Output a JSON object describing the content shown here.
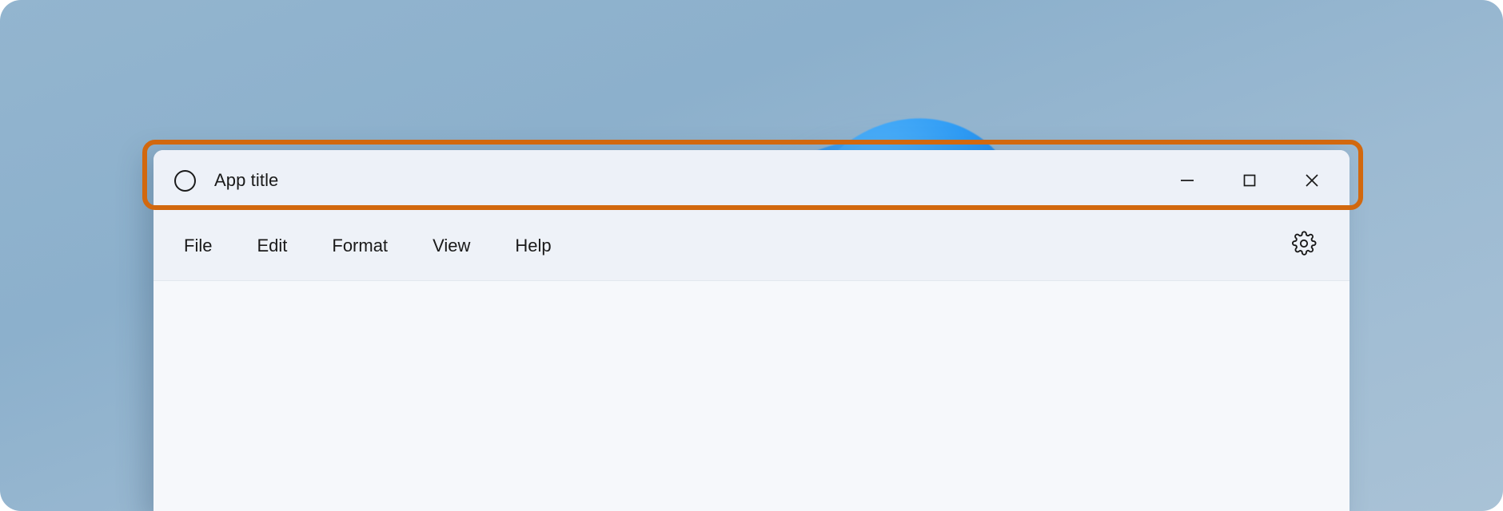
{
  "window": {
    "title": "App title",
    "app_icon": "circle-outline-icon",
    "controls": [
      {
        "name": "minimize",
        "glyph": "minimize-icon",
        "label": "Minimize"
      },
      {
        "name": "maximize",
        "glyph": "maximize-icon",
        "label": "Maximize"
      },
      {
        "name": "close",
        "glyph": "close-icon",
        "label": "Close"
      }
    ]
  },
  "menu_bar": {
    "items": [
      {
        "label": "File"
      },
      {
        "label": "Edit"
      },
      {
        "label": "Format"
      },
      {
        "label": "View"
      },
      {
        "label": "Help"
      }
    ],
    "settings_icon": "gear-icon"
  },
  "content": {
    "text": ""
  },
  "annotation": {
    "target": "title-bar",
    "color": "#d2680e"
  },
  "colors": {
    "desktop": "#8cb0cc",
    "title_bar": "#edf1f8",
    "menu_bar": "#eef2f8",
    "content": "#f6f8fb",
    "text": "#1a1a1a",
    "highlight": "#d2680e",
    "bloom_blue": "#2690f0"
  }
}
